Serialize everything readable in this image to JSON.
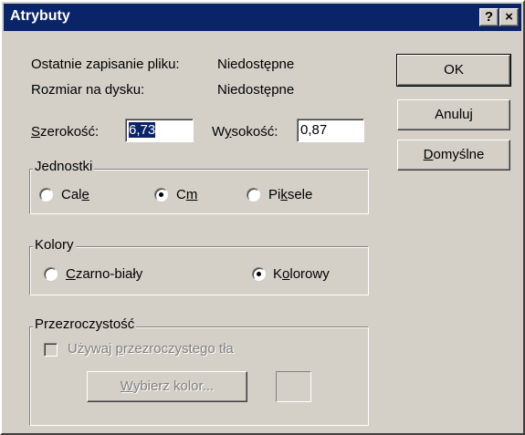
{
  "window": {
    "title": "Atrybuty",
    "help_button": "?",
    "close_button": "×"
  },
  "info": {
    "last_saved_label": "Ostatnie zapisanie pliku:",
    "last_saved_value": "Niedostępne",
    "disk_size_label": "Rozmiar na dysku:",
    "disk_size_value": "Niedostępne"
  },
  "dimensions": {
    "width_label_accel": "S",
    "width_label_rest": "zerokość:",
    "width_value": "6,73",
    "height_label_pre": "W",
    "height_label_accel": "y",
    "height_label_rest": "sokość:",
    "height_value": "0,87"
  },
  "units": {
    "legend": "Jednostki",
    "inches_pre": "Cal",
    "inches_accel": "e",
    "cm_pre": "C",
    "cm_accel": "m",
    "pixels_pre": "Pi",
    "pixels_accel": "k",
    "pixels_rest": "sele",
    "selected": "Cm"
  },
  "colors": {
    "legend": "Kolory",
    "bw_accel": "C",
    "bw_rest": "zarno-biały",
    "color_pre": "K",
    "color_accel": "o",
    "color_rest": "lorowy",
    "selected": "Kolorowy"
  },
  "transparency": {
    "legend": "Przezroczystość",
    "use_pre": "Używaj ",
    "use_accel": "p",
    "use_rest": "rzezroczystego tła",
    "choose_accel": "W",
    "choose_rest": "ybierz kolor..."
  },
  "buttons": {
    "ok": "OK",
    "cancel": "Anuluj",
    "defaults_accel": "D",
    "defaults_rest": "omyślne"
  },
  "colors_theme": {
    "titlebar": "#0a246a",
    "face": "#d4d0c8",
    "selection": "#0a246a"
  }
}
